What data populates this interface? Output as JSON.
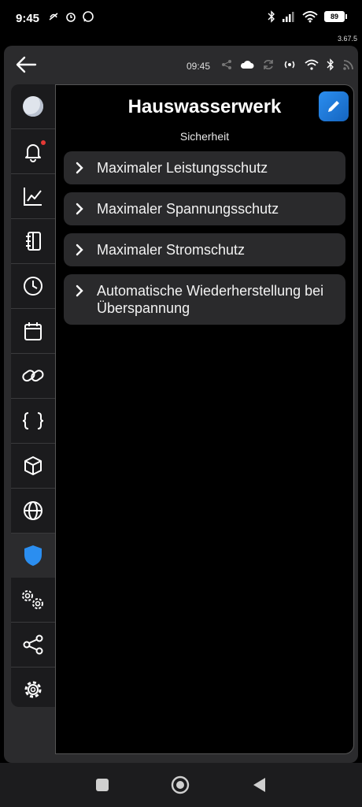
{
  "status_bar": {
    "time": "9:45",
    "battery": "89"
  },
  "app_version": "3.67.5",
  "header": {
    "time": "09:45"
  },
  "page": {
    "title": "Hauswasserwerk",
    "subtitle": "Sicherheit"
  },
  "sidebar": {
    "items": [
      {
        "icon": "avatar-icon"
      },
      {
        "icon": "bell-icon",
        "badge": true
      },
      {
        "icon": "chart-line-icon"
      },
      {
        "icon": "notebook-icon"
      },
      {
        "icon": "clock-icon"
      },
      {
        "icon": "calendar-icon"
      },
      {
        "icon": "link-icon"
      },
      {
        "icon": "braces-icon"
      },
      {
        "icon": "cube-icon"
      },
      {
        "icon": "globe-icon"
      },
      {
        "icon": "shield-icon",
        "active": true
      },
      {
        "icon": "gears-icon"
      },
      {
        "icon": "share-icon"
      },
      {
        "icon": "settings-icon"
      }
    ]
  },
  "settings_list": [
    {
      "label": "Maximaler Leistungsschutz"
    },
    {
      "label": "Maximaler Spannungsschutz"
    },
    {
      "label": "Maximaler Stromschutz"
    },
    {
      "label": "Automatische Wiederherstellung bei Überspannung"
    }
  ],
  "colors": {
    "accent": "#2b8ef0",
    "row_bg": "#2a2a2c",
    "frame": "#2b2b2d"
  }
}
